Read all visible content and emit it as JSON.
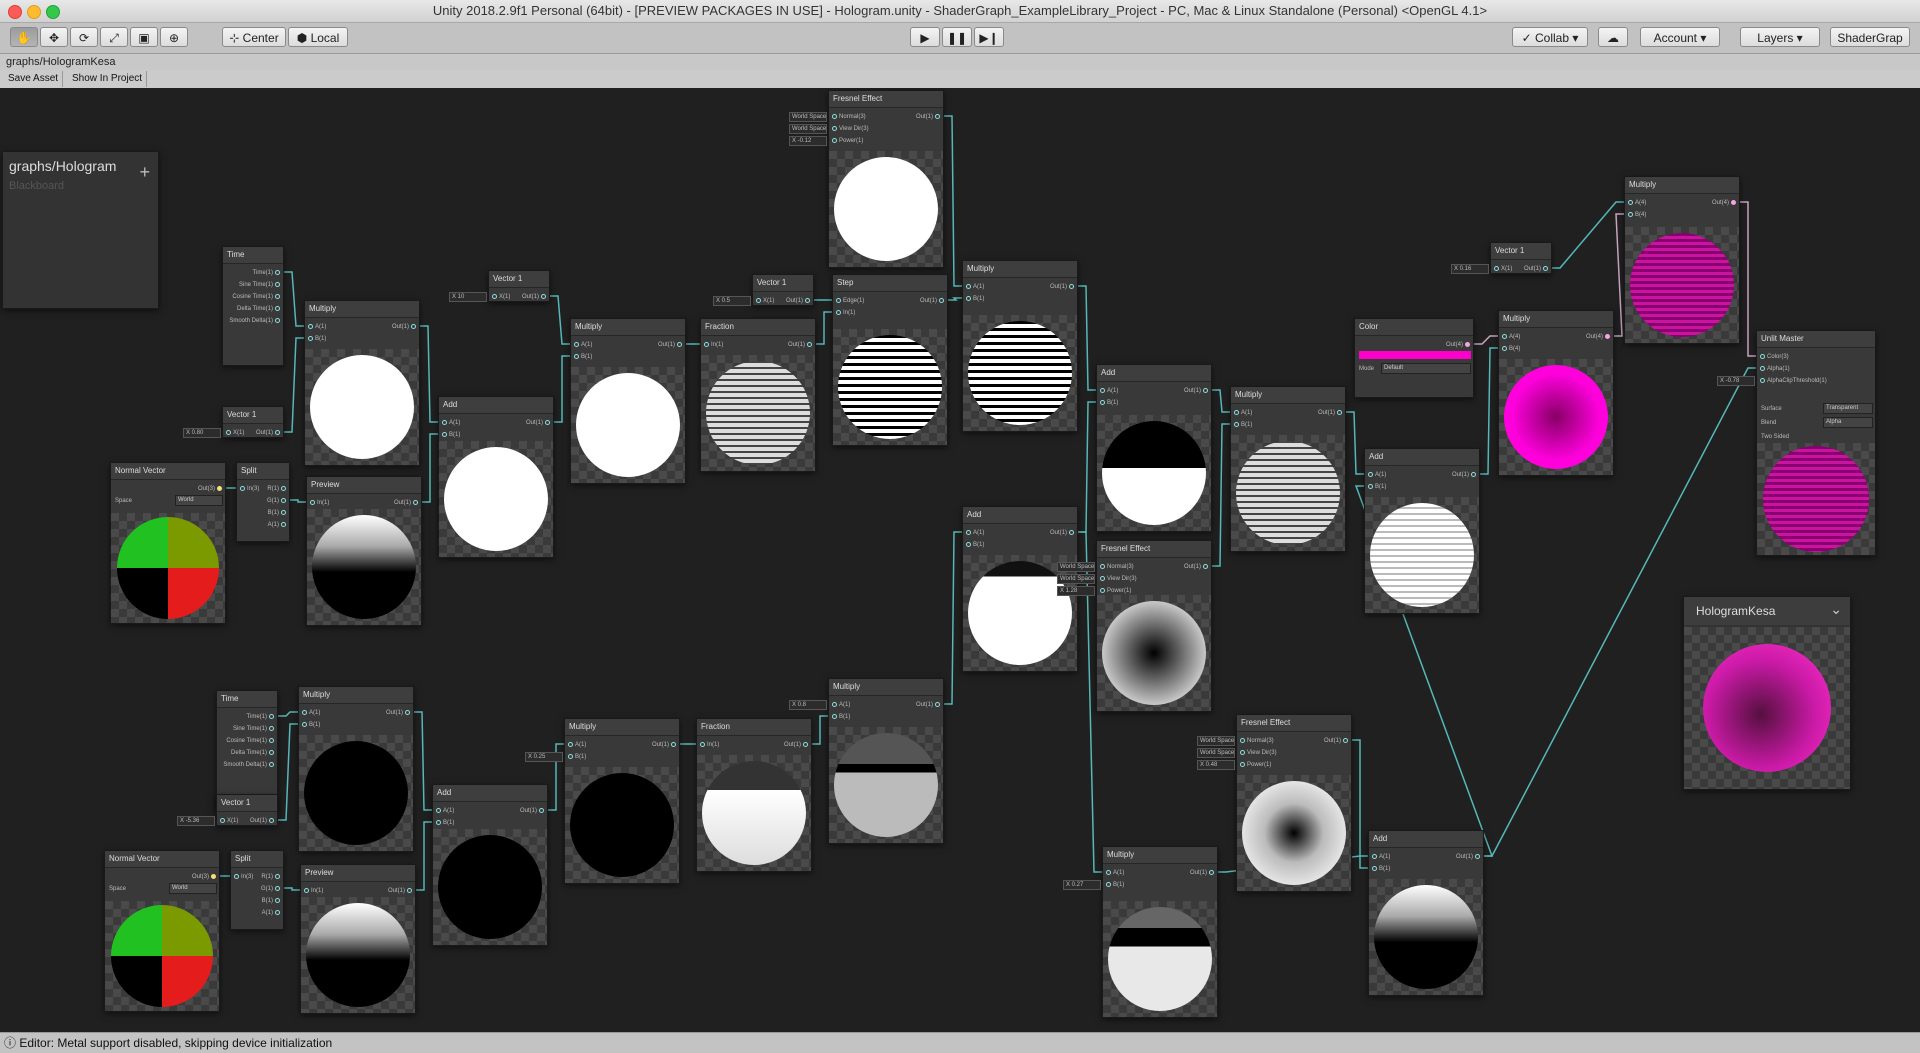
{
  "window": {
    "title": "Unity 2018.2.9f1 Personal (64bit) - [PREVIEW PACKAGES IN USE] - Hologram.unity - ShaderGraph_ExampleLibrary_Project - PC, Mac & Linux Standalone (Personal) <OpenGL 4.1>"
  },
  "toolbar": {
    "center": "Center",
    "local": "Local",
    "collab": "Collab",
    "account": "Account",
    "layers": "Layers",
    "layout": "ShaderGrap"
  },
  "breadcrumb": "graphs/HologramKesa",
  "sg_toolbar": {
    "save": "Save Asset",
    "show": "Show In Project"
  },
  "blackboard": {
    "title": "graphs/Hologram",
    "subtitle": "Blackboard",
    "add": "+"
  },
  "preview_window": {
    "title": "HologramKesa",
    "chevron": "⌄"
  },
  "status": {
    "text": "Editor: Metal support disabled, skipping device initialization"
  },
  "labels": {
    "time": "Time",
    "time1": "Time(1)",
    "sin": "Sine Time(1)",
    "cos": "Cosine Time(1)",
    "dt": "Delta Time(1)",
    "sdt": "Smooth Delta(1)",
    "multiply": "Multiply",
    "add": "Add",
    "vector1": "Vector 1",
    "fraction": "Fraction",
    "step": "Step",
    "fresnel": "Fresnel Effect",
    "color": "Color",
    "master": "Unlit Master",
    "normal_vector": "Normal Vector",
    "split": "Split",
    "preview": "Preview",
    "a": "A(1)",
    "b": "B(1)",
    "a4": "A(4)",
    "b4": "B(4)",
    "out": "Out(1)",
    "out4": "Out(4)",
    "out3": "Out(3)",
    "in": "In(1)",
    "in3": "In(3)",
    "x": "X(1)",
    "edge": "Edge(1)",
    "r": "R(1)",
    "g": "G(1)",
    "bb": "B(1)",
    "aa": "A(1)",
    "normal": "Normal(3)",
    "viewdir": "View Dir(3)",
    "power": "Power(1)",
    "ws": "World Space",
    "space": "Space",
    "world": "World",
    "mode": "Mode",
    "default": "Default",
    "color3": "Color(3)",
    "alpha": "Alpha(1)",
    "clip": "AlphaClipThreshold(1)",
    "surface": "Surface",
    "blend": "Blend",
    "twosided": "Two Sided",
    "transparent": "Transparent",
    "alphaopt": "Alpha"
  },
  "values": {
    "v1a": "X 10",
    "v1b": "X 0.5",
    "v1c": "X 0.80",
    "v1d": "X 0.16",
    "v1e": "X -5.36",
    "fp1": "X -0.12",
    "fp2": "X 1.28",
    "fp3": "X 0.48",
    "m1": "X 0.25",
    "m2": "X 0.8",
    "m3": "X 0.27",
    "master_x": "X -0.78"
  },
  "colors": {
    "wire": "#56b8b8",
    "magenta": "#ff00cc",
    "canvas": "#202020"
  }
}
